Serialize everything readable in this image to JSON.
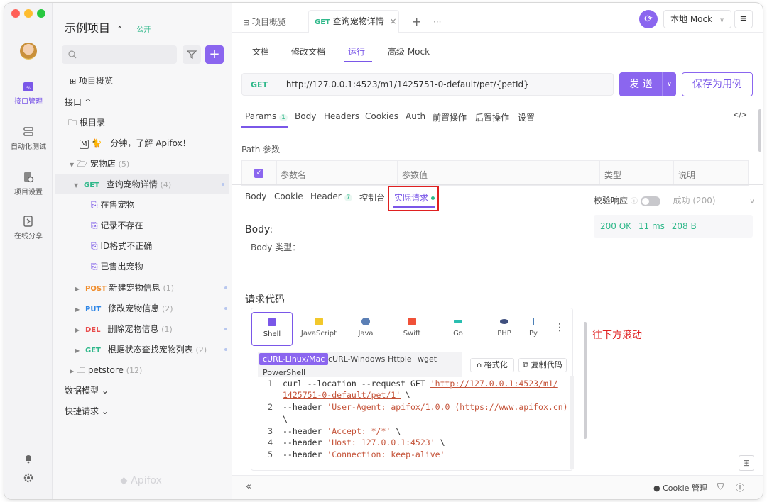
{
  "project": {
    "name": "示例项目",
    "switch_glyph": "⌃",
    "visibility": "公开"
  },
  "rail": {
    "items": [
      {
        "label": "接口管理",
        "icon": "api-calendar-icon"
      },
      {
        "label": "自动化测试",
        "icon": "automation-icon"
      },
      {
        "label": "项目设置",
        "icon": "settings-gear-doc-icon"
      },
      {
        "label": "在线分享",
        "icon": "share-doc-icon"
      }
    ],
    "colors": {
      "active": "#7a57e8"
    }
  },
  "sidebar": {
    "search_placeholder": "",
    "overview": "项目概览",
    "api_section": "接口 ^",
    "root": "根目录",
    "intro_doc": "🐈一分钟，了解 Apifox！",
    "folder_pet": {
      "name": "宠物店",
      "count": "(5)"
    },
    "active_api": {
      "method": "GET",
      "name": "查询宠物详情",
      "count": "(4)"
    },
    "cases": [
      "在售宠物",
      "记录不存在",
      "ID格式不正确",
      "已售出宠物"
    ],
    "apis": [
      {
        "method": "POST",
        "name": "新建宠物信息",
        "count": "(1)"
      },
      {
        "method": "PUT",
        "name": "修改宠物信息",
        "count": "(2)"
      },
      {
        "method": "DEL",
        "name": "删除宠物信息",
        "count": "(1)"
      },
      {
        "method": "GET",
        "name": "根据状态查找宠物列表",
        "count": "(2)"
      }
    ],
    "folder_petstore": {
      "name": "petstore",
      "count": "(12)"
    },
    "data_model": "数据模型 ⌄",
    "quick_request": "快捷请求 ⌄",
    "brand": "Apifox"
  },
  "tabs": {
    "overview": "项目概览",
    "active": {
      "method": "GET",
      "name": "查询宠物详情"
    },
    "add": "+",
    "more": "···",
    "env": "本地 Mock"
  },
  "subtabs": [
    "文档",
    "修改文档",
    "运行",
    "高级 Mock"
  ],
  "request": {
    "method": "GET",
    "url": "http://127.0.0.1:4523/m1/1425751-0-default/pet/{petId}",
    "send": "发 送",
    "save": "保存为用例"
  },
  "param_tabs": {
    "params": "Params",
    "params_count": "1",
    "others": [
      "Body",
      "Headers",
      "Cookies",
      "Auth",
      "前置操作",
      "后置操作",
      "设置"
    ],
    "code_icon": "</>"
  },
  "path_params": {
    "title": "Path 参数",
    "headers": [
      "参数名",
      "参数值",
      "类型",
      "说明"
    ]
  },
  "response_tabs": {
    "items": [
      "Body",
      "Cookie"
    ],
    "header": "Header",
    "header_count": "7",
    "console": "控制台",
    "actual": "实际请求"
  },
  "body": {
    "title": "Body:",
    "type_label": "Body 类型："
  },
  "code": {
    "title": "请求代码",
    "langs": [
      "Shell",
      "JavaScript",
      "Java",
      "Swift",
      "Go",
      "PHP",
      "Py"
    ],
    "variants": [
      "cURL-Linux/Mac",
      "cURL-Windows",
      "Httpie",
      "wget",
      "PowerShell"
    ],
    "format": "格式化",
    "copy": "复制代码",
    "lines": [
      {
        "n": "1",
        "parts": [
          {
            "t": "curl --location --request GET ",
            "s": false
          },
          {
            "t": "'http://127.0.0.1:4523/m1/",
            "s": true
          }
        ]
      },
      {
        "n": "",
        "parts": [
          {
            "t": "1425751-0-default/pet/1'",
            "s": true
          },
          {
            "t": " \\",
            "s": false
          }
        ]
      },
      {
        "n": "2",
        "parts": [
          {
            "t": "--header ",
            "s": false
          },
          {
            "t": "'User-Agent: apifox/1.0.0 (https://www.apifox.cn)'",
            "s": true
          }
        ]
      },
      {
        "n": "",
        "parts": [
          {
            "t": "\\",
            "s": false
          }
        ]
      },
      {
        "n": "3",
        "parts": [
          {
            "t": "--header ",
            "s": false
          },
          {
            "t": "'Accept: */*'",
            "s": true
          },
          {
            "t": " \\",
            "s": false
          }
        ]
      },
      {
        "n": "4",
        "parts": [
          {
            "t": "--header ",
            "s": false
          },
          {
            "t": "'Host: 127.0.0.1:4523'",
            "s": true
          },
          {
            "t": " \\",
            "s": false
          }
        ]
      },
      {
        "n": "5",
        "parts": [
          {
            "t": "--header ",
            "s": false
          },
          {
            "t": "'Connection: keep-alive'",
            "s": true
          }
        ]
      }
    ]
  },
  "annotation": "往下方滚动",
  "validate": {
    "label": "校验响应",
    "result": "成功 (200)"
  },
  "status": {
    "code": "200 OK",
    "time": "11 ms",
    "size": "208 B"
  },
  "footer": {
    "collapse": "«",
    "cookie": "Cookie 管理"
  }
}
